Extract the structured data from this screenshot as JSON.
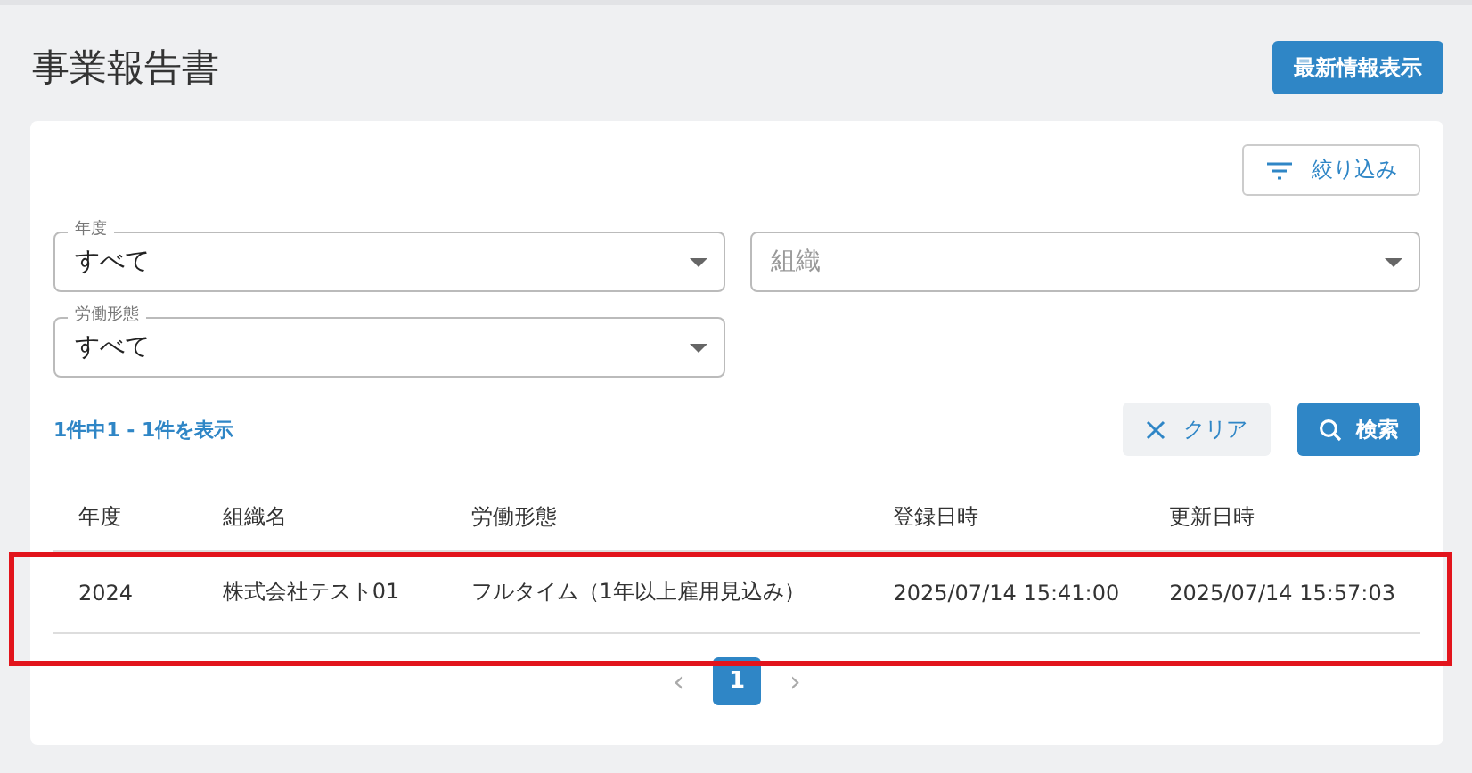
{
  "page_title": "事業報告書",
  "latest_button": "最新情報表示",
  "filter_button": "絞り込み",
  "selects": [
    {
      "label": "年度",
      "value": "すべて"
    },
    {
      "placeholder": "組織"
    },
    {
      "label": "労働形態",
      "value": "すべて"
    }
  ],
  "result_count": "1件中1 - 1件を表示",
  "clear_button": "クリア",
  "search_button": "検索",
  "table": {
    "columns": [
      "年度",
      "組織名",
      "労働形態",
      "登録日時",
      "更新日時"
    ],
    "rows": [
      {
        "highlighted": true,
        "cells": [
          "2024",
          "株式会社テスト01",
          "フルタイム（1年以上雇用見込み）",
          "2025/07/14 15:41:00",
          "2025/07/14 15:57:03"
        ]
      }
    ]
  },
  "pagination": {
    "prev": "‹",
    "next": "›",
    "pages": [
      {
        "label": "1",
        "selected": true
      }
    ]
  }
}
